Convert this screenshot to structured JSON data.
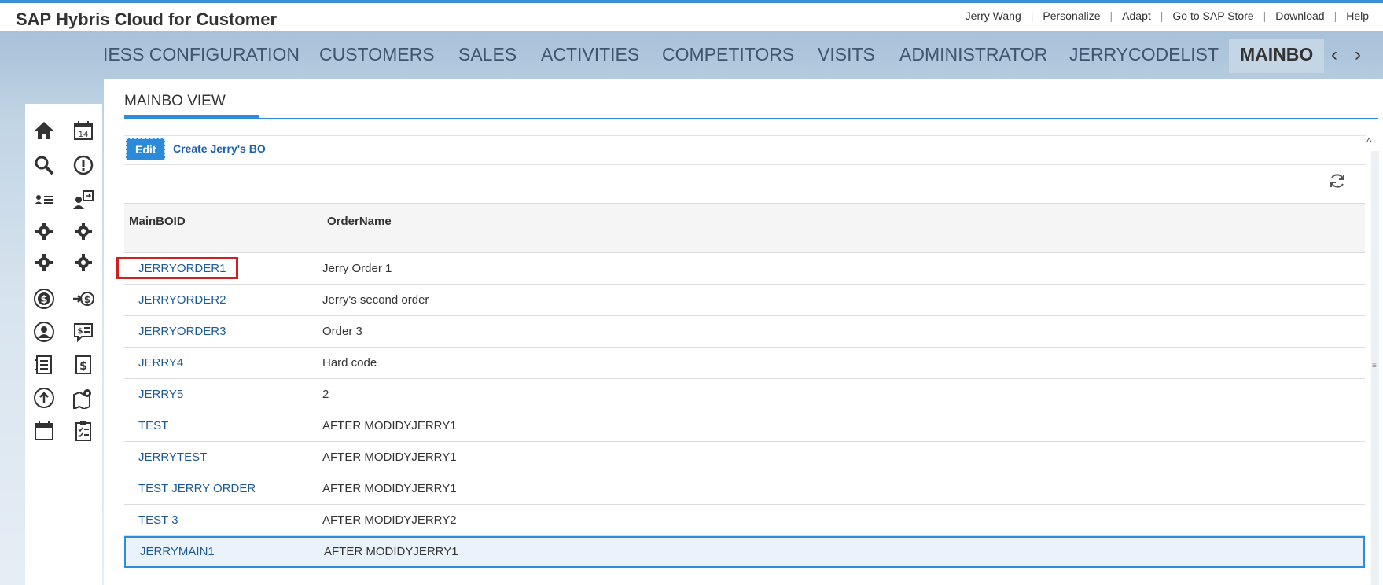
{
  "app": {
    "title": "SAP Hybris Cloud for Customer"
  },
  "header_links": [
    "Jerry Wang",
    "Personalize",
    "Adapt",
    "Go to SAP Store",
    "Download",
    "Help"
  ],
  "nav": {
    "tabs": [
      "IESS CONFIGURATION",
      "CUSTOMERS",
      "SALES",
      "ACTIVITIES",
      "COMPETITORS",
      "VISITS",
      "ADMINISTRATOR",
      "JERRYCODELIST"
    ],
    "active_tab": "MAINBO",
    "prev_arrow": "‹",
    "next_arrow": "›"
  },
  "left_icons": [
    "home-icon",
    "calendar-14-icon",
    "search-icon",
    "alert-icon",
    "contacts-list-icon",
    "customer-switch-icon",
    "gear-icon",
    "gear-icon",
    "gear-icon",
    "gear-icon",
    "dollar-circle-icon",
    "dollar-arrow-icon",
    "person-circle-icon",
    "dollar-chat-icon",
    "document-list-icon",
    "invoice-icon",
    "upload-circle-icon",
    "map-pin-icon",
    "calendar-icon",
    "clipboard-check-icon"
  ],
  "view": {
    "tab_label": "MAINBO VIEW"
  },
  "toolbar": {
    "edit_label": "Edit",
    "create_label": "Create Jerry's BO"
  },
  "table": {
    "columns": [
      "MainBOID",
      "OrderName"
    ],
    "rows": [
      {
        "id": "JERRYORDER1",
        "name": "Jerry Order 1"
      },
      {
        "id": "JERRYORDER2",
        "name": "Jerry's second order"
      },
      {
        "id": "JERRYORDER3",
        "name": "Order 3"
      },
      {
        "id": "JERRY4",
        "name": "Hard code"
      },
      {
        "id": "JERRY5",
        "name": "2"
      },
      {
        "id": "TEST",
        "name": "AFTER MODIDYJERRY1"
      },
      {
        "id": "JERRYTEST",
        "name": "AFTER MODIDYJERRY1"
      },
      {
        "id": "TEST JERRY ORDER",
        "name": "AFTER MODIDYJERRY1"
      },
      {
        "id": "TEST 3",
        "name": "AFTER MODIDYJERRY2"
      },
      {
        "id": "JERRYMAIN1",
        "name": "AFTER MODIDYJERRY1"
      }
    ],
    "selected_row": 9,
    "highlighted_row": 0
  },
  "colors": {
    "accent": "#2d8ce0",
    "link": "#1e5a96",
    "highlight": "#d12020"
  }
}
